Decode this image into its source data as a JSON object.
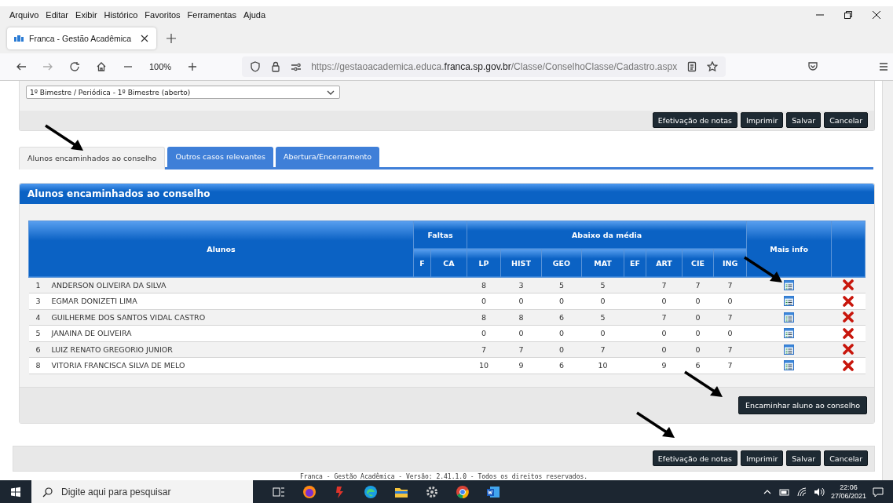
{
  "menu_bar": {
    "items": [
      "Arquivo",
      "Editar",
      "Exibir",
      "Histórico",
      "Favoritos",
      "Ferramentas",
      "Ajuda"
    ]
  },
  "browser_tabs": [
    {
      "title": "Franca - Gestão Acadêmica",
      "selected": true
    }
  ],
  "address_bar": {
    "zoom": "100%",
    "url_prefix": "https://gestaoacademica.educa.",
    "url_domain": "franca.sp.gov.br",
    "url_path": "/Classe/ConselhoClasse/Cadastro.aspx"
  },
  "period_select": {
    "value": "1º Bimestre / Periódica - 1º Bimestre (aberto)"
  },
  "top_buttons": [
    "Efetivação de notas",
    "Imprimir",
    "Salvar",
    "Cancelar"
  ],
  "tabs": [
    {
      "label": "Alunos encaminhados ao conselho",
      "selected": true
    },
    {
      "label": "Outros casos relevantes",
      "selected": false
    },
    {
      "label": "Abertura/Encerramento",
      "selected": false
    }
  ],
  "section": {
    "title": "Alunos encaminhados ao conselho",
    "table": {
      "column_groups": [
        {
          "kind": "single",
          "label": "Alunos"
        },
        {
          "kind": "group",
          "label": "Faltas",
          "columns": [
            "F",
            "CA"
          ]
        },
        {
          "kind": "group",
          "label": "Abaixo da média",
          "columns": [
            "LP",
            "HIST",
            "GEO",
            "MAT",
            "EF",
            "ART",
            "CIE",
            "ING"
          ]
        },
        {
          "kind": "single",
          "label": "Mais info"
        },
        {
          "kind": "single"
        }
      ],
      "rows": [
        {
          "number": "1",
          "name": "ANDERSON OLIVEIRA DA SILVA",
          "cells": [
            {
              "kind": "blank"
            },
            {
              "kind": "blank"
            },
            {
              "kind": "value",
              "text": "8"
            },
            {
              "kind": "value",
              "text": "3"
            },
            {
              "kind": "value",
              "text": "5"
            },
            {
              "kind": "value",
              "text": "5"
            },
            {
              "kind": "blank"
            },
            {
              "kind": "value",
              "text": "7"
            },
            {
              "kind": "value",
              "text": "7"
            },
            {
              "kind": "value",
              "text": "7"
            }
          ]
        },
        {
          "number": "3",
          "name": "EGMAR DONIZETI LIMA",
          "cells": [
            {
              "kind": "blank"
            },
            {
              "kind": "blank"
            },
            {
              "kind": "value",
              "text": "0"
            },
            {
              "kind": "value",
              "text": "0"
            },
            {
              "kind": "value",
              "text": "0"
            },
            {
              "kind": "value",
              "text": "0"
            },
            {
              "kind": "blank"
            },
            {
              "kind": "value",
              "text": "0"
            },
            {
              "kind": "value",
              "text": "0"
            },
            {
              "kind": "value",
              "text": "0"
            }
          ]
        },
        {
          "number": "4",
          "name": "GUILHERME DOS SANTOS VIDAL CASTRO",
          "cells": [
            {
              "kind": "blank"
            },
            {
              "kind": "blank"
            },
            {
              "kind": "value",
              "text": "8"
            },
            {
              "kind": "value",
              "text": "8"
            },
            {
              "kind": "value",
              "text": "6"
            },
            {
              "kind": "value",
              "text": "5"
            },
            {
              "kind": "blank"
            },
            {
              "kind": "value",
              "text": "7"
            },
            {
              "kind": "value",
              "text": "0"
            },
            {
              "kind": "value",
              "text": "7"
            }
          ]
        },
        {
          "number": "5",
          "name": "JANAINA DE OLIVEIRA",
          "cells": [
            {
              "kind": "blank"
            },
            {
              "kind": "blank"
            },
            {
              "kind": "value",
              "text": "0"
            },
            {
              "kind": "value",
              "text": "0"
            },
            {
              "kind": "value",
              "text": "0"
            },
            {
              "kind": "value",
              "text": "0"
            },
            {
              "kind": "blank"
            },
            {
              "kind": "value",
              "text": "0"
            },
            {
              "kind": "value",
              "text": "0"
            },
            {
              "kind": "value",
              "text": "0"
            }
          ]
        },
        {
          "number": "6",
          "name": "LUIZ RENATO GREGORIO JUNIOR",
          "cells": [
            {
              "kind": "blank"
            },
            {
              "kind": "blank"
            },
            {
              "kind": "value",
              "text": "7"
            },
            {
              "kind": "value",
              "text": "7"
            },
            {
              "kind": "value",
              "text": "0"
            },
            {
              "kind": "value",
              "text": "7"
            },
            {
              "kind": "blank"
            },
            {
              "kind": "value",
              "text": "0"
            },
            {
              "kind": "value",
              "text": "0"
            },
            {
              "kind": "value",
              "text": "7"
            }
          ]
        },
        {
          "number": "8",
          "name": "VITORIA FRANCISCA SILVA DE MELO",
          "cells": [
            {
              "kind": "blank"
            },
            {
              "kind": "blank"
            },
            {
              "kind": "value",
              "text": "10"
            },
            {
              "kind": "value",
              "text": "9"
            },
            {
              "kind": "value",
              "text": "6"
            },
            {
              "kind": "value",
              "text": "10"
            },
            {
              "kind": "blank"
            },
            {
              "kind": "value",
              "text": "9"
            },
            {
              "kind": "value",
              "text": "6"
            },
            {
              "kind": "value",
              "text": "7"
            }
          ]
        }
      ]
    },
    "action_button": "Encaminhar aluno ao conselho"
  },
  "bottom_buttons": [
    "Efetivação de notas",
    "Imprimir",
    "Salvar",
    "Cancelar"
  ],
  "footer": "Franca - Gestão Acadêmica - Versão: 2.41.1.0 - Todos os direitos reservados.",
  "taskbar": {
    "search_placeholder": "Digite aqui para pesquisar",
    "time": "22:06",
    "date": "27/06/2021"
  }
}
